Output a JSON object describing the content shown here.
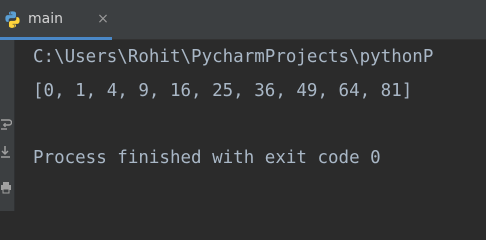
{
  "tab": {
    "label": "main",
    "close_symbol": "×",
    "icon": "python-icon"
  },
  "gutter": {
    "icons": [
      "soft-wrap-icon",
      "scroll-to-end-icon",
      "print-icon"
    ]
  },
  "console": {
    "path_line": "C:\\Users\\Rohit\\PycharmProjects\\pythonP",
    "output_line": "[0, 1, 4, 9, 16, 25, 36, 49, 64, 81]",
    "exit_line": "Process finished with exit code 0"
  },
  "colors": {
    "background": "#2b2b2b",
    "tabbar": "#3c3f41",
    "text": "#a9b7c6",
    "accent": "#4a88c7"
  }
}
